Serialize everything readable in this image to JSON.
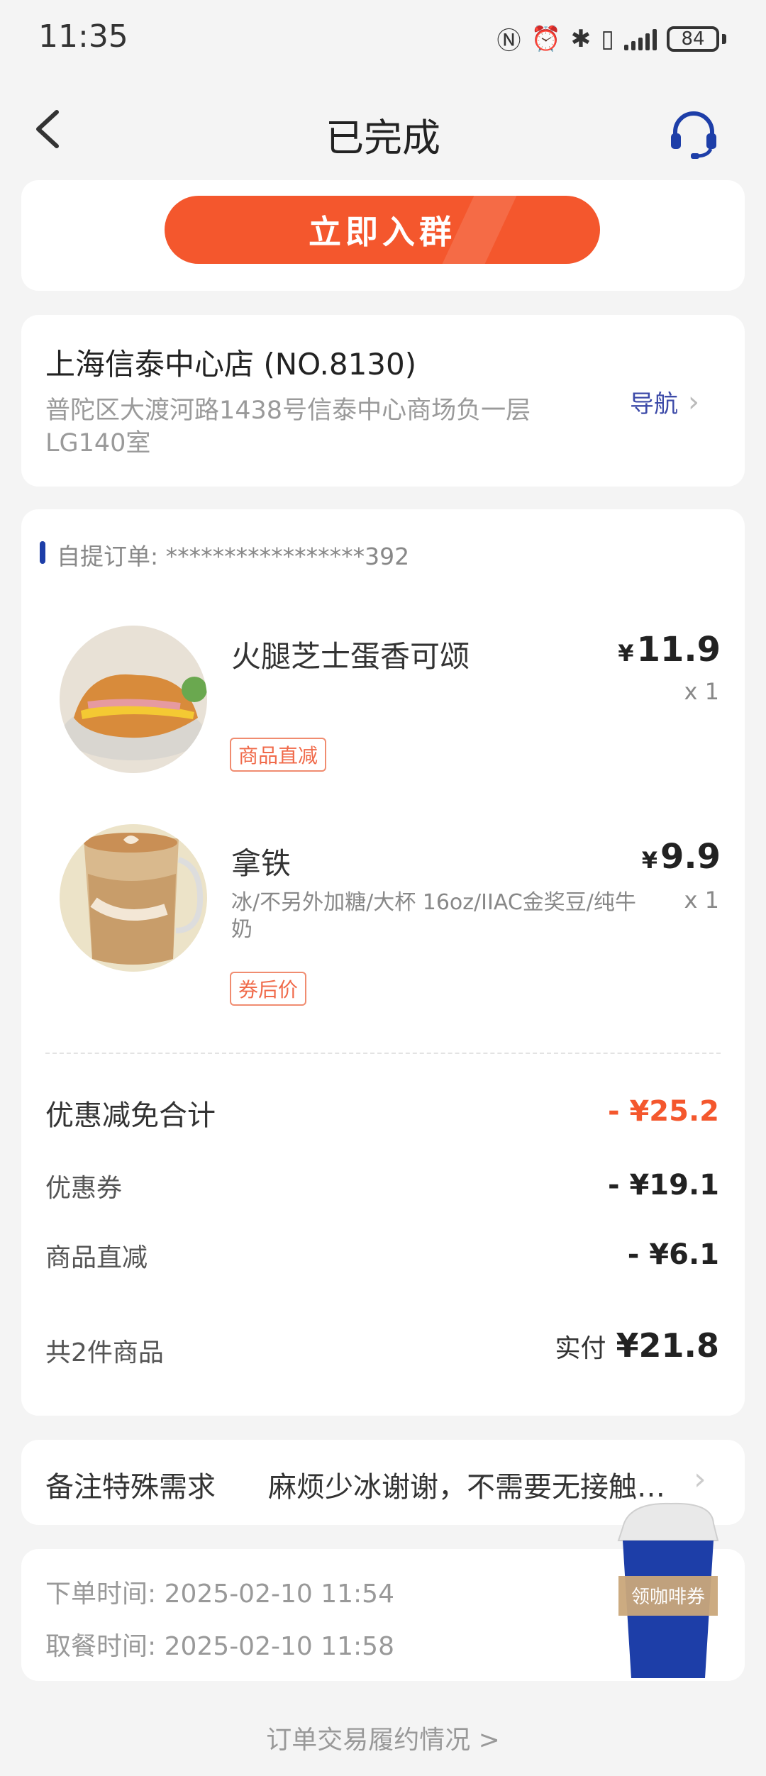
{
  "status": {
    "time": "11:35",
    "battery": "84"
  },
  "header": {
    "title": "已完成"
  },
  "join_group": {
    "label": "立即入群"
  },
  "store": {
    "name": "上海信泰中心店 (NO.8130)",
    "address": "普陀区大渡河路1438号信泰中心商场负一层LG140室",
    "nav_label": "导航"
  },
  "order": {
    "number_label": "自提订单: *****************392",
    "items": [
      {
        "name": "火腿芝士蛋香可颂",
        "spec": "",
        "tag": "商品直减",
        "currency": "¥",
        "price": "11.9",
        "qty": "x 1"
      },
      {
        "name": "拿铁",
        "spec": "冰/不另外加糖/大杯 16oz/IIAC金奖豆/纯牛奶",
        "tag": "券后价",
        "currency": "¥",
        "price": "9.9",
        "qty": "x 1"
      }
    ],
    "discount_total_label": "优惠减免合计",
    "discount_total_value": "- ¥25.2",
    "coupon_label": "优惠券",
    "coupon_value": "- ¥19.1",
    "direct_label": "商品直减",
    "direct_value": "- ¥6.1",
    "count_label": "共2件商品",
    "paid_label": "实付",
    "paid_value": "¥21.8"
  },
  "remark": {
    "label": "备注特殊需求",
    "value": "麻烦少冰谢谢，不需要无接触配送"
  },
  "times": {
    "order_time": "下单时间:  2025-02-10 11:54",
    "pickup_time": "取餐时间:  2025-02-10 11:58"
  },
  "coffee_coupon": {
    "label": "领咖啡券"
  },
  "footer": {
    "link": "订单交易履约情况 >"
  },
  "colors": {
    "accent": "#f4572d",
    "brand_blue": "#1d3ea8"
  }
}
